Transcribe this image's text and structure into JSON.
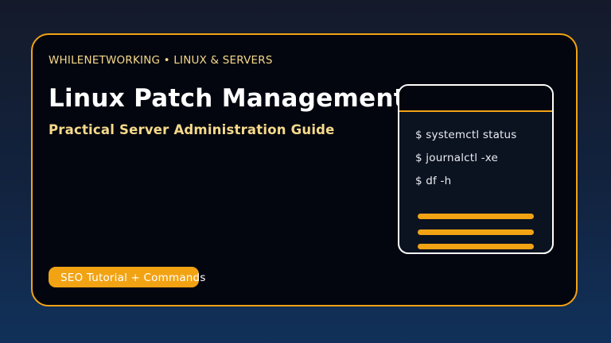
{
  "card": {
    "eyebrow": "WHILENETWORKING • LINUX & SERVERS",
    "title": "Linux Patch Management",
    "subtitle": "Practical Server Administration Guide",
    "badge": "SEO Tutorial + Commands"
  },
  "terminal": {
    "commands": [
      "$ systemctl status",
      "$ journalctl -xe",
      "$ df -h"
    ]
  },
  "colors": {
    "accent": "#f2a314",
    "highlight_text": "#f6d98a",
    "card_background": "#03060f",
    "page_background_top": "#141a2a",
    "page_background_bottom": "#11315a"
  }
}
